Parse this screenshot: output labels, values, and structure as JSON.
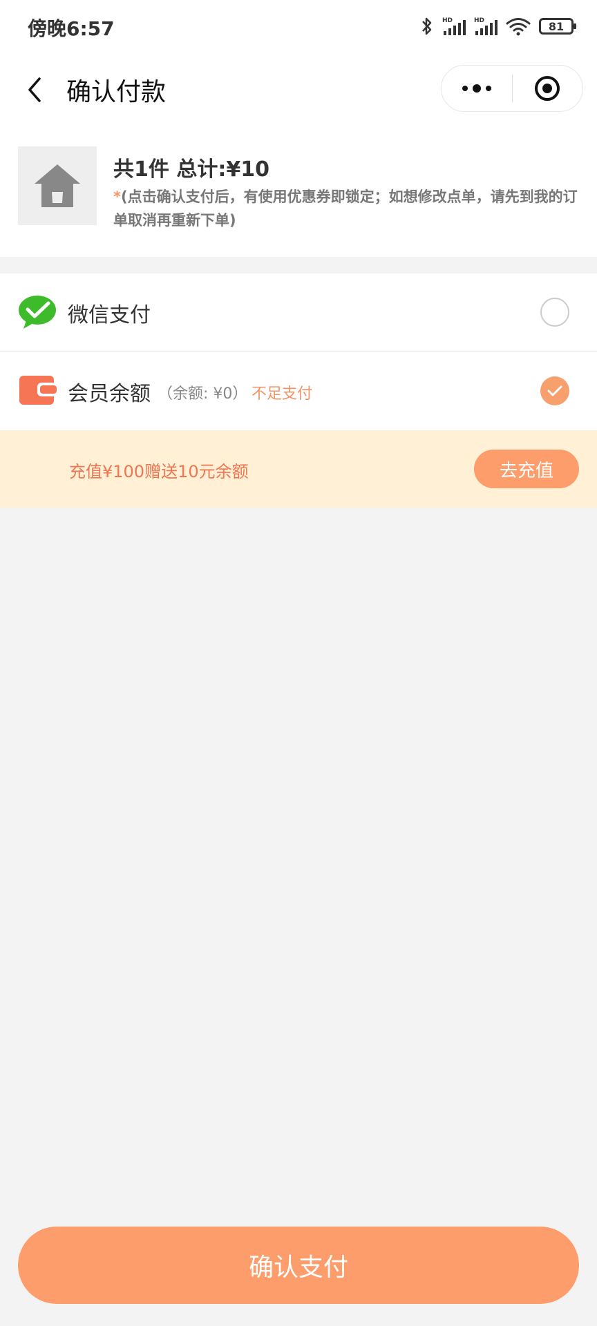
{
  "status_bar": {
    "time": "傍晚6:57",
    "battery": "81"
  },
  "nav": {
    "title": "确认付款"
  },
  "order": {
    "summary": "共1件 总计:¥10",
    "note_star": "*",
    "note": "(点击确认支付后，有使用优惠券即锁定；如想修改点单，请先到我的订单取消再重新下单)"
  },
  "payment": {
    "wechat_label": "微信支付",
    "member_label": "会员余额",
    "balance_note": "（余额: ¥0）",
    "insufficient": "不足支付",
    "selected": "member"
  },
  "recharge": {
    "promo": "充值¥100赠送10元余额",
    "button_label": "去充值"
  },
  "footer": {
    "confirm_label": "确认支付"
  },
  "colors": {
    "accent": "#fc9d6b",
    "promo_bg": "#fff0d6",
    "promo_text": "#f07550",
    "wechat_green": "#3dbb2a"
  },
  "icons": {
    "back": "chevron-left-icon",
    "more": "more-dots-icon",
    "close": "target-close-icon",
    "product": "home-icon",
    "wechat": "wechat-pay-icon",
    "wallet": "wallet-icon",
    "check": "checkmark-icon"
  }
}
